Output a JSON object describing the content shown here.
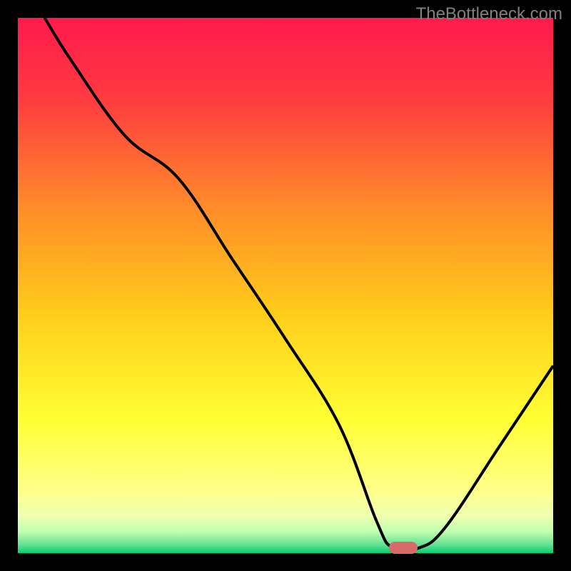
{
  "watermark": "TheBottleneck.com",
  "chart_data": {
    "type": "line",
    "title": "",
    "xlabel": "",
    "ylabel": "",
    "xlim": [
      0,
      100
    ],
    "ylim": [
      0,
      100
    ],
    "series": [
      {
        "name": "curve",
        "x": [
          5,
          10,
          20,
          30,
          40,
          50,
          60,
          67,
          70,
          75,
          80,
          90,
          100
        ],
        "values": [
          100,
          92,
          78,
          70,
          55,
          40,
          24,
          6,
          1,
          1,
          5,
          20,
          35
        ]
      }
    ],
    "marker": {
      "x": 72,
      "y": 1
    },
    "gradient_stops": [
      {
        "pos": 0.0,
        "color": "#ff1a4d"
      },
      {
        "pos": 0.15,
        "color": "#ff3a40"
      },
      {
        "pos": 0.35,
        "color": "#ff8a2a"
      },
      {
        "pos": 0.55,
        "color": "#ffcc1a"
      },
      {
        "pos": 0.75,
        "color": "#ffff33"
      },
      {
        "pos": 0.88,
        "color": "#ffff88"
      },
      {
        "pos": 0.93,
        "color": "#f0ffb0"
      },
      {
        "pos": 0.96,
        "color": "#c0ffb0"
      },
      {
        "pos": 0.985,
        "color": "#60e090"
      },
      {
        "pos": 1.0,
        "color": "#00d070"
      }
    ]
  }
}
